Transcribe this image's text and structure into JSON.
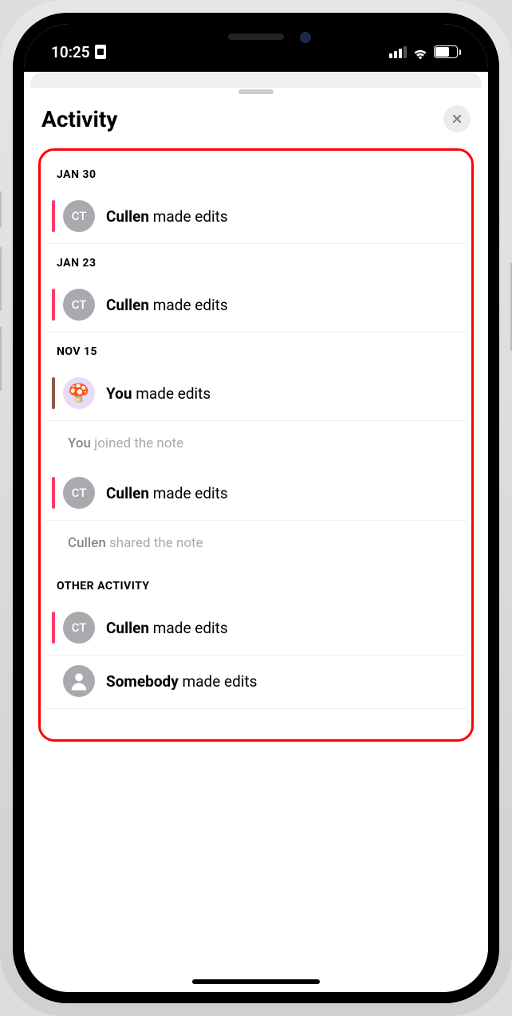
{
  "status_bar": {
    "time": "10:25",
    "battery_pct": "59"
  },
  "sheet": {
    "title": "Activity"
  },
  "groups": [
    {
      "heading": "JAN 30",
      "items": [
        {
          "kind": "edit",
          "edge": "pink",
          "avatar_type": "initials",
          "avatar_value": "CT",
          "actor": "Cullen",
          "action": "made edits"
        }
      ]
    },
    {
      "heading": "JAN 23",
      "items": [
        {
          "kind": "edit",
          "edge": "pink",
          "avatar_type": "initials",
          "avatar_value": "CT",
          "actor": "Cullen",
          "action": "made edits"
        }
      ]
    },
    {
      "heading": "NOV 15",
      "items": [
        {
          "kind": "edit",
          "edge": "brown",
          "avatar_type": "you",
          "avatar_value": "🍄",
          "actor": "You",
          "action": "made edits"
        },
        {
          "kind": "meta",
          "actor": "You",
          "action": "joined the note"
        },
        {
          "kind": "edit",
          "edge": "pink",
          "avatar_type": "initials",
          "avatar_value": "CT",
          "actor": "Cullen",
          "action": "made edits"
        },
        {
          "kind": "meta",
          "actor": "Cullen",
          "action": "shared the note"
        }
      ]
    },
    {
      "heading": "OTHER ACTIVITY",
      "items": [
        {
          "kind": "edit",
          "edge": "pink",
          "avatar_type": "initials",
          "avatar_value": "CT",
          "actor": "Cullen",
          "action": "made edits"
        },
        {
          "kind": "edit",
          "edge": "none",
          "avatar_type": "generic",
          "avatar_value": "",
          "actor": "Somebody",
          "action": "made edits"
        }
      ]
    }
  ]
}
